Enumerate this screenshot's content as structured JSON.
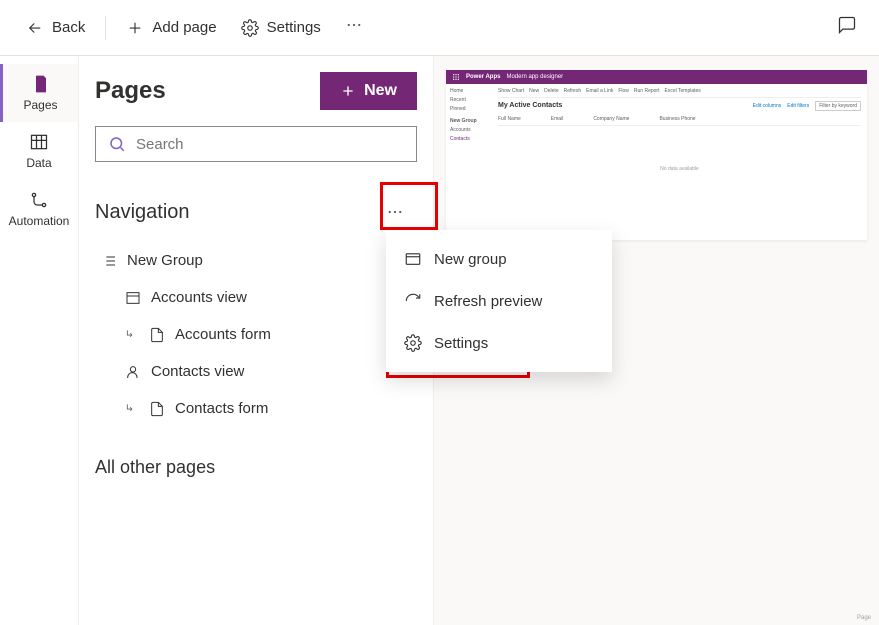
{
  "toolbar": {
    "back": "Back",
    "add_page": "Add page",
    "settings": "Settings"
  },
  "rail": {
    "pages": "Pages",
    "data": "Data",
    "automation": "Automation"
  },
  "panel": {
    "title": "Pages",
    "new_btn": "New",
    "search_placeholder": "Search",
    "navigation_title": "Navigation",
    "group_label": "New Group",
    "accounts_view": "Accounts view",
    "accounts_form": "Accounts form",
    "contacts_view": "Contacts view",
    "contacts_form": "Contacts form",
    "all_other": "All other pages"
  },
  "ctx": {
    "new_group": "New group",
    "refresh": "Refresh preview",
    "settings": "Settings"
  },
  "preview": {
    "app_name": "Power Apps",
    "designer": "Modern app designer",
    "side_home": "Home",
    "side_recent": "Recent",
    "side_pinned": "Pinned",
    "side_group": "New Group",
    "side_accounts": "Accounts",
    "side_contacts": "Contacts",
    "cmd_showchart": "Show Chart",
    "cmd_new": "New",
    "cmd_delete": "Delete",
    "cmd_refresh": "Refresh",
    "cmd_email": "Email a Link",
    "cmd_flow": "Flow",
    "cmd_runreport": "Run Report",
    "cmd_excel": "Excel Templates",
    "view_title": "My Active Contacts",
    "col_fullname": "Full Name",
    "col_email": "Email",
    "col_company": "Company Name",
    "col_phone": "Business Phone",
    "link_editcolumns": "Edit columns",
    "link_editfilters": "Edit filters",
    "filter_placeholder": "Filter by keyword",
    "empty_text": "No data available",
    "page_label": "Page"
  }
}
